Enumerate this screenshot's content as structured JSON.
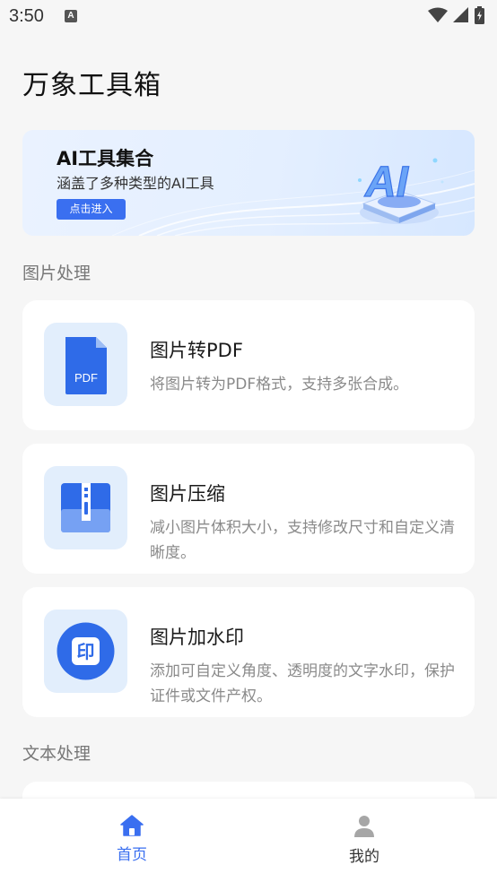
{
  "status_bar": {
    "time": "3:50",
    "notification_letter": "A"
  },
  "header": {
    "title": "万象工具箱"
  },
  "banner": {
    "title": "AI工具集合",
    "subtitle": "涵盖了多种类型的AI工具",
    "button_label": "点击进入",
    "art_text": "AI"
  },
  "sections": [
    {
      "title": "图片处理",
      "cards": [
        {
          "title": "图片转PDF",
          "description": "将图片转为PDF格式，支持多张合成。",
          "icon": "pdf-file-icon",
          "icon_text": "PDF"
        },
        {
          "title": "图片压缩",
          "description": "减小图片体积大小，支持修改尺寸和自定义清晰度。",
          "icon": "zip-archive-icon"
        },
        {
          "title": "图片加水印",
          "description": "添加可自定义角度、透明度的文字水印，保护证件或文件产权。",
          "icon": "stamp-icon",
          "icon_text": "印"
        }
      ]
    },
    {
      "title": "文本处理"
    }
  ],
  "bottom_nav": {
    "items": [
      {
        "label": "首页",
        "icon": "home-icon",
        "active": true
      },
      {
        "label": "我的",
        "icon": "user-icon",
        "active": false
      }
    ]
  },
  "colors": {
    "accent": "#3a6ff0",
    "background": "#f6f6f6",
    "icon_bg": "#e2eefc",
    "inactive": "#333333"
  }
}
